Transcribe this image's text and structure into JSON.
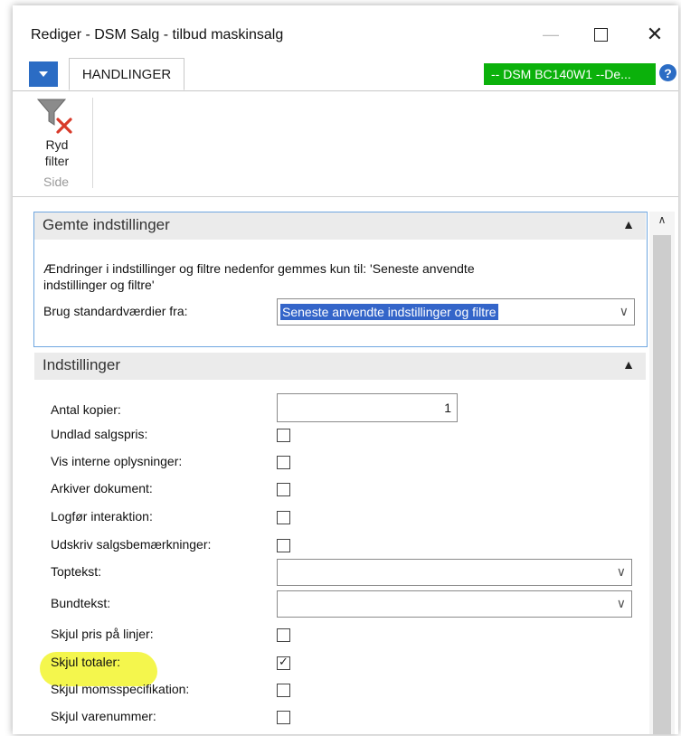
{
  "window": {
    "title": "Rediger - DSM Salg - tilbud maskinsalg",
    "minimize_glyph": "—",
    "close_glyph": "✕"
  },
  "tabs": {
    "active": "HANDLINGER"
  },
  "environment_badge": "--  DSM BC140W1 --De...",
  "help_glyph": "?",
  "ribbon": {
    "clear_filter_line1": "Ryd",
    "clear_filter_line2": "filter",
    "group_label": "Side"
  },
  "saved_settings": {
    "header": "Gemte indstillinger",
    "info_text": "Ændringer i indstillinger og filtre nedenfor gemmes kun til: 'Seneste anvendte indstillinger og filtre'",
    "defaults_label": "Brug standardværdier fra:",
    "defaults_value": "Seneste anvendte indstillinger og filtre"
  },
  "settings": {
    "header": "Indstillinger",
    "fields": [
      {
        "label": "Antal kopier:",
        "type": "number",
        "value": "1"
      },
      {
        "label": "Undlad salgspris:",
        "type": "checkbox",
        "checked": false
      },
      {
        "label": "Vis interne oplysninger:",
        "type": "checkbox",
        "checked": false
      },
      {
        "label": "Arkiver dokument:",
        "type": "checkbox",
        "checked": false
      },
      {
        "label": "Logfør interaktion:",
        "type": "checkbox",
        "checked": false
      },
      {
        "label": "Udskriv salgsbemærkninger:",
        "type": "checkbox",
        "checked": false
      },
      {
        "label": "Toptekst:",
        "type": "dropdown",
        "value": ""
      },
      {
        "label": "Bundtekst:",
        "type": "dropdown",
        "value": ""
      },
      {
        "label": "Skjul pris på linjer:",
        "type": "checkbox",
        "checked": false
      },
      {
        "label": "Skjul totaler:",
        "type": "checkbox",
        "checked": true,
        "highlighted": true
      },
      {
        "label": "Skjul momsspecifikation:",
        "type": "checkbox",
        "checked": false
      },
      {
        "label": "Skjul varenummer:",
        "type": "checkbox",
        "checked": false
      }
    ]
  },
  "colors": {
    "accent_blue": "#2b6cc4",
    "env_green": "#0bb10b",
    "highlight_yellow": "#f3f53a"
  },
  "icons": {
    "clear_filter": "funnel-with-red-x-icon",
    "collapse": "chevron-up-icon",
    "dropdown": "chevron-down-icon",
    "check": "check-icon"
  }
}
